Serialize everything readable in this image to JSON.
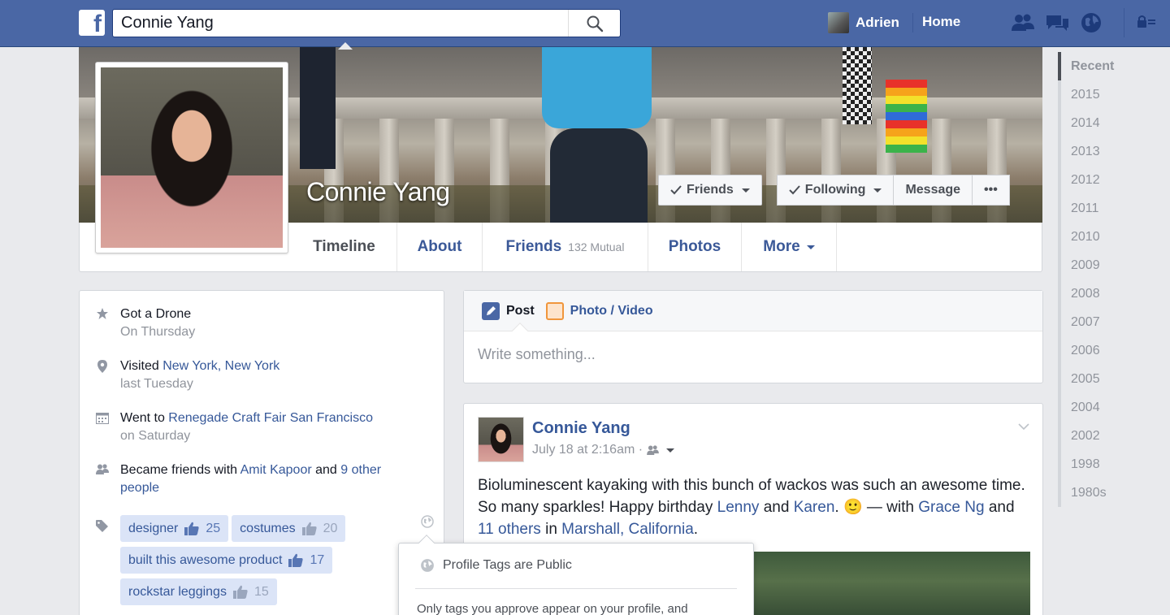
{
  "topbar": {
    "logo": "f",
    "search_value": "Connie Yang",
    "user_name": "Adrien",
    "home_label": "Home",
    "icons": [
      "friend-requests-icon",
      "messages-icon",
      "notifications-globe-icon",
      "privacy-shortcuts-icon"
    ]
  },
  "profile": {
    "name": "Connie Yang",
    "buttons": {
      "friends": "Friends",
      "following": "Following",
      "message": "Message",
      "more_dots": "•••"
    },
    "tabs": [
      {
        "label": "Timeline"
      },
      {
        "label": "About"
      },
      {
        "label": "Friends",
        "extra": "132 Mutual"
      },
      {
        "label": "Photos"
      },
      {
        "label": "More"
      }
    ]
  },
  "years": [
    "Recent",
    "2015",
    "2014",
    "2013",
    "2012",
    "2011",
    "2010",
    "2009",
    "2008",
    "2007",
    "2006",
    "2005",
    "2004",
    "2002",
    "1998",
    "1980s"
  ],
  "activity": [
    {
      "icon": "star-icon",
      "pre": "Got a Drone",
      "link": "",
      "post": "",
      "sub": "On Thursday"
    },
    {
      "icon": "location-pin-icon",
      "pre": "Visited ",
      "link": "New York, New York",
      "post": "",
      "sub": "last Tuesday"
    },
    {
      "icon": "calendar-icon",
      "pre": "Went to ",
      "link": "Renegade Craft Fair San Francisco",
      "post": "",
      "sub": "on Saturday"
    },
    {
      "icon": "friends-icon",
      "pre": "Became friends with ",
      "link": "Amit Kapoor",
      "post": " and ",
      "link2": "9 other people",
      "sub": ""
    }
  ],
  "tags": [
    {
      "label": "designer",
      "count": "25"
    },
    {
      "label": "costumes",
      "count": "20"
    },
    {
      "label": "built this awesome product",
      "count": "17"
    },
    {
      "label": "rockstar leggings",
      "count": "15"
    }
  ],
  "tooltip": {
    "title": "Profile Tags are Public",
    "body": "Only tags you approve appear on your profile, and"
  },
  "composer": {
    "post_label": "Post",
    "photo_label": "Photo / Video",
    "placeholder": "Write something..."
  },
  "post": {
    "author": "Connie Yang",
    "time": "July 18 at 2:16am ·",
    "text_1": "Bioluminescent kayaking with this bunch of wackos was such an awesome time. So many sparkles! Happy birthday ",
    "link_lenny": "Lenny",
    "and_1": " and ",
    "link_karen": "Karen",
    "text_2": ". ",
    "emoji": "🙂",
    "text_3": " — with ",
    "link_grace": "Grace Ng",
    "and_2": " and ",
    "link_others": "11 others",
    "in": " in ",
    "link_place": "Marshall, California",
    "end": "."
  }
}
